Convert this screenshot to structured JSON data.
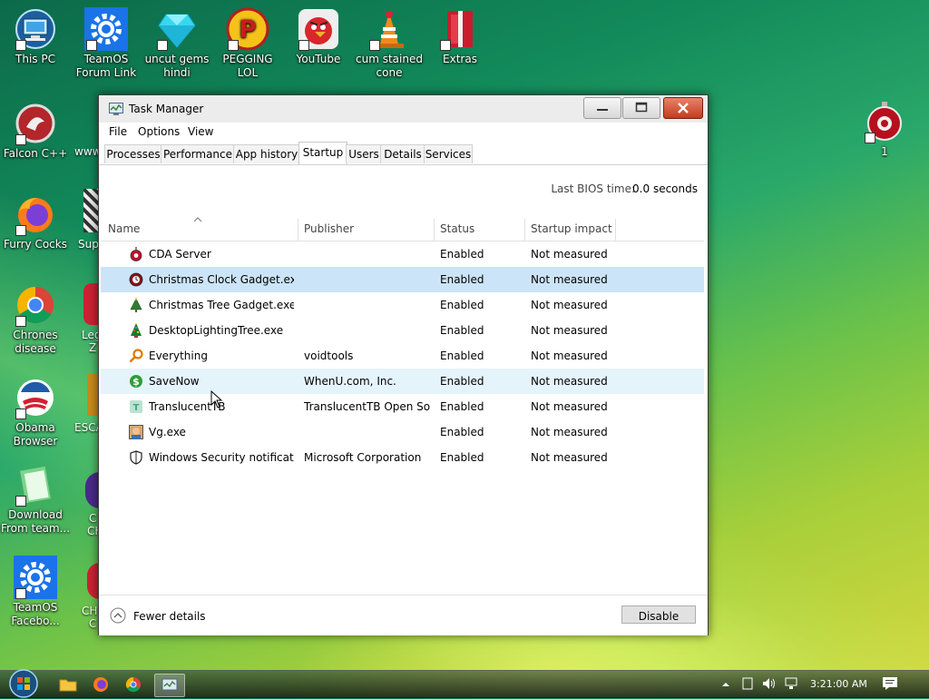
{
  "desktop": {
    "icons": [
      {
        "label": "This PC",
        "icon": "computer-icon"
      },
      {
        "label": "TeamOS\nForum Link",
        "icon": "gear-icon"
      },
      {
        "label": "uncut gems\nhindi",
        "icon": "diamond-icon"
      },
      {
        "label": "PEGGING LOL",
        "icon": "p-logo-icon"
      },
      {
        "label": "YouTube",
        "icon": "angry-bird-icon"
      },
      {
        "label": "cum stained\ncone",
        "icon": "traffic-cone-icon"
      },
      {
        "label": "Extras",
        "icon": "gift-box-icon"
      },
      {
        "label": "Falcon C++",
        "icon": "falcon-icon"
      },
      {
        "label": "Furry Cocks",
        "icon": "firefox-icon"
      },
      {
        "label": "Chrones\ndisease",
        "icon": "chrome-icon"
      },
      {
        "label": "Obama\nBrowser",
        "icon": "obama-logo-icon"
      },
      {
        "label": "Download\nFrom team...",
        "icon": "notepad-icon"
      },
      {
        "label": "TeamOS\nFacebo...",
        "icon": "gear-icon"
      },
      {
        "label": "1",
        "icon": "ornament-icon"
      }
    ],
    "partial_labels": [
      "www",
      "Supe",
      "Leg",
      "Z",
      "ESCA",
      "C",
      "CH",
      "CH",
      "C"
    ]
  },
  "window": {
    "title": "Task Manager",
    "menu": [
      "File",
      "Options",
      "View"
    ],
    "tabs": [
      "Processes",
      "Performance",
      "App history",
      "Startup",
      "Users",
      "Details",
      "Services"
    ],
    "active_tab": "Startup",
    "bios_label": "Last BIOS time:",
    "bios_value": "0.0 seconds",
    "columns": [
      "Name",
      "Publisher",
      "Status",
      "Startup impact"
    ],
    "rows": [
      {
        "name": "CDA Server",
        "publisher": "",
        "status": "Enabled",
        "impact": "Not measured",
        "icon": "red-ornament-icon"
      },
      {
        "name": "Christmas Clock Gadget.exe",
        "publisher": "",
        "status": "Enabled",
        "impact": "Not measured",
        "icon": "clock-ornament-icon"
      },
      {
        "name": "Christmas Tree Gadget.exe",
        "publisher": "",
        "status": "Enabled",
        "impact": "Not measured",
        "icon": "tree-icon"
      },
      {
        "name": "DesktopLightingTree.exe",
        "publisher": "",
        "status": "Enabled",
        "impact": "Not measured",
        "icon": "lit-tree-icon"
      },
      {
        "name": "Everything",
        "publisher": "voidtools",
        "status": "Enabled",
        "impact": "Not measured",
        "icon": "magnifier-icon"
      },
      {
        "name": "SaveNow",
        "publisher": "WhenU.com, Inc.",
        "status": "Enabled",
        "impact": "Not measured",
        "icon": "dollar-icon"
      },
      {
        "name": "TranslucentTB",
        "publisher": "TranslucentTB Open Sou...",
        "status": "Enabled",
        "impact": "Not measured",
        "icon": "translucent-tb-icon"
      },
      {
        "name": "Vg.exe",
        "publisher": "",
        "status": "Enabled",
        "impact": "Not measured",
        "icon": "vg-icon"
      },
      {
        "name": "Windows Security notificati...",
        "publisher": "Microsoft Corporation",
        "status": "Enabled",
        "impact": "Not measured",
        "icon": "shield-icon"
      }
    ],
    "selected_row": "Christmas Clock Gadget.exe",
    "hover_row": "SaveNow",
    "footer": {
      "fewer_details": "Fewer details",
      "disable": "Disable"
    }
  },
  "taskbar": {
    "clock": "3:21:00 AM"
  },
  "colors": {
    "selected_row": "#cce4f7",
    "hover_row": "#e5f3fb",
    "close_button": "#c94025"
  }
}
